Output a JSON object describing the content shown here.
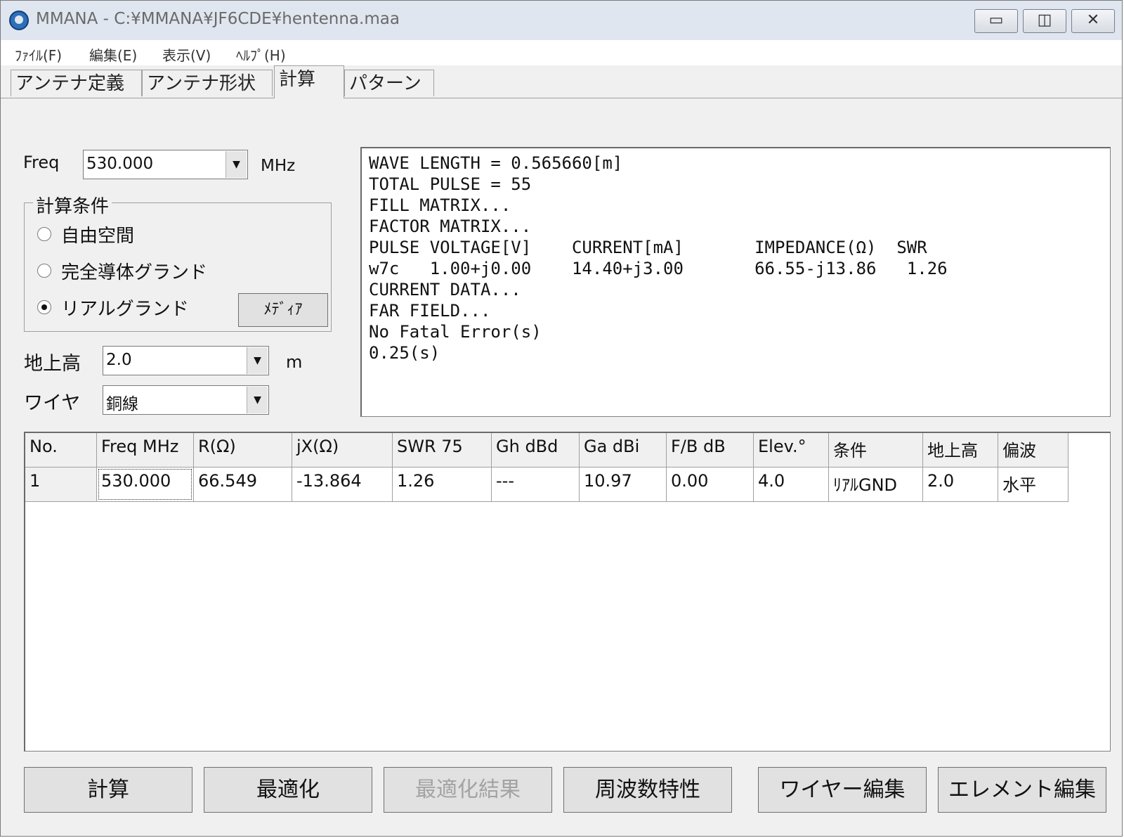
{
  "window": {
    "title": "MMANA - C:¥MMANA¥JF6CDE¥hentenna.maa",
    "minimize_icon": "minimize-icon",
    "maximize_icon": "maximize-icon",
    "close_icon": "close-icon"
  },
  "menu": [
    "ﾌｧｲﾙ(F)",
    "編集(E)",
    "表示(V)",
    "ﾍﾙﾌﾟ(H)"
  ],
  "tabs": [
    {
      "label": "アンテナ定義",
      "active": false
    },
    {
      "label": "アンテナ形状",
      "active": false
    },
    {
      "label": "計算",
      "active": true
    },
    {
      "label": "パターン",
      "active": false
    }
  ],
  "freq": {
    "label": "Freq",
    "value": "530.000",
    "unit": "MHz"
  },
  "conditions": {
    "title": "計算条件",
    "options": [
      {
        "label": "自由空間",
        "checked": false
      },
      {
        "label": "完全導体グランド",
        "checked": false
      },
      {
        "label": "リアルグランド",
        "checked": true
      }
    ],
    "media_button": "ﾒﾃﾞｨｱ"
  },
  "height": {
    "label": "地上高",
    "value": "2.0",
    "unit": "m"
  },
  "wire": {
    "label": "ワイヤ",
    "value": "銅線"
  },
  "output_lines": [
    "WAVE LENGTH = 0.565660[m]",
    "TOTAL PULSE = 55",
    "FILL MATRIX...",
    "FACTOR MATRIX...",
    "PULSE VOLTAGE[V]    CURRENT[mA]       IMPEDANCE(Ω)  SWR",
    "w7c   1.00+j0.00    14.40+j3.00       66.55-j13.86   1.26",
    "CURRENT DATA...",
    "FAR FIELD...",
    "No Fatal Error(s)",
    "0.25(s)"
  ],
  "results_table": {
    "columns": [
      "No.",
      "Freq MHz",
      "R(Ω)",
      "jX(Ω)",
      "SWR 75",
      "Gh dBd",
      "Ga dBi",
      "F/B dB",
      "Elev.°",
      "条件",
      "地上高",
      "偏波"
    ],
    "rows": [
      [
        "1",
        "530.000",
        "66.549",
        "-13.864",
        "1.26",
        "---",
        "10.97",
        "0.00",
        "4.0",
        "ﾘｱﾙGND",
        "2.0",
        "水平"
      ]
    ]
  },
  "buttons": [
    {
      "label": "計算",
      "enabled": true
    },
    {
      "label": "最適化",
      "enabled": true
    },
    {
      "label": "最適化結果",
      "enabled": false
    },
    {
      "label": "周波数特性",
      "enabled": true
    },
    {
      "label": "ワイヤー編集",
      "enabled": true
    },
    {
      "label": "エレメント編集",
      "enabled": true
    }
  ]
}
